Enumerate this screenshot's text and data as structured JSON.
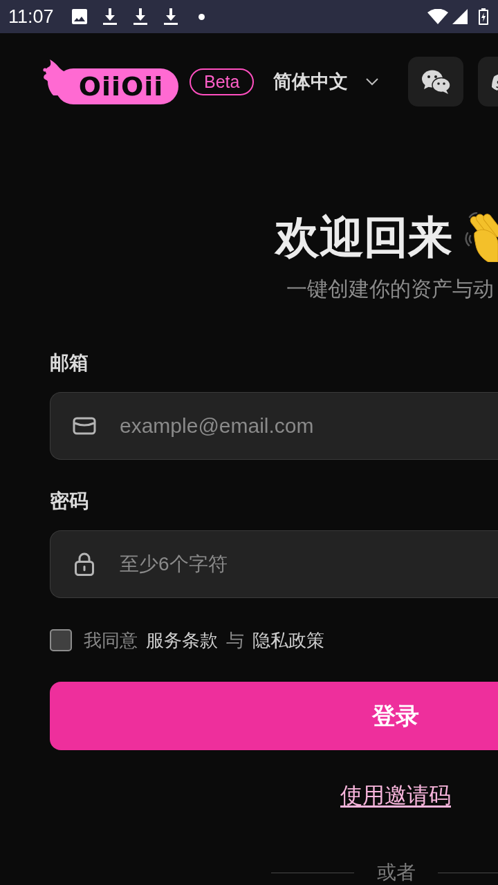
{
  "status_bar": {
    "time": "11:07"
  },
  "header": {
    "logo_text": "OiiOii",
    "badge": "Beta",
    "language": "简体中文"
  },
  "welcome": {
    "title": "欢迎回来",
    "subtitle": "一键创建你的资产与动"
  },
  "form": {
    "fields": [
      {
        "kind": "email",
        "label": "邮箱",
        "placeholder": "example@email.com"
      },
      {
        "kind": "password",
        "label": "密码",
        "placeholder": "至少6个字符"
      }
    ],
    "agreement": {
      "checked": false,
      "text": "我同意",
      "terms_link": "服务条款",
      "conjunction": "与",
      "privacy_link": "隐私政策"
    },
    "submit": "登录",
    "invite_link": "使用邀请码",
    "divider": "或者"
  }
}
